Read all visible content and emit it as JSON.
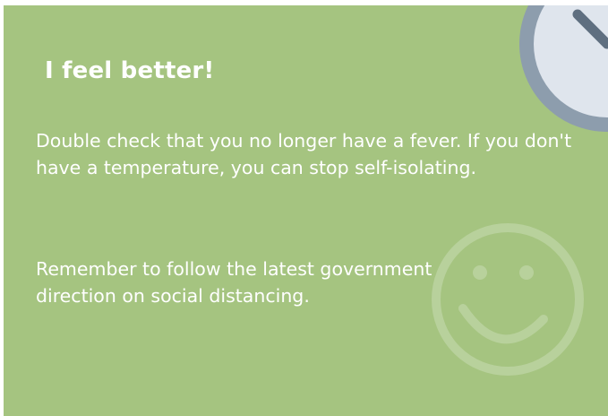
{
  "card": {
    "title": "I feel better!",
    "paragraph_1": "Double check that you no longer have a fever. If you don't have a temperature, you can stop self-isolating.",
    "paragraph_2": "Remember to follow the latest government direction on social distancing."
  },
  "decorations": {
    "top_right": "clock-icon",
    "bottom_right": "smiley-face-icon"
  },
  "colors": {
    "card_background": "#a5c480",
    "text": "#ffffff",
    "clock_face": "#dfe5ed",
    "clock_rim": "#8d9dad",
    "clock_hand": "#5f6f80"
  }
}
